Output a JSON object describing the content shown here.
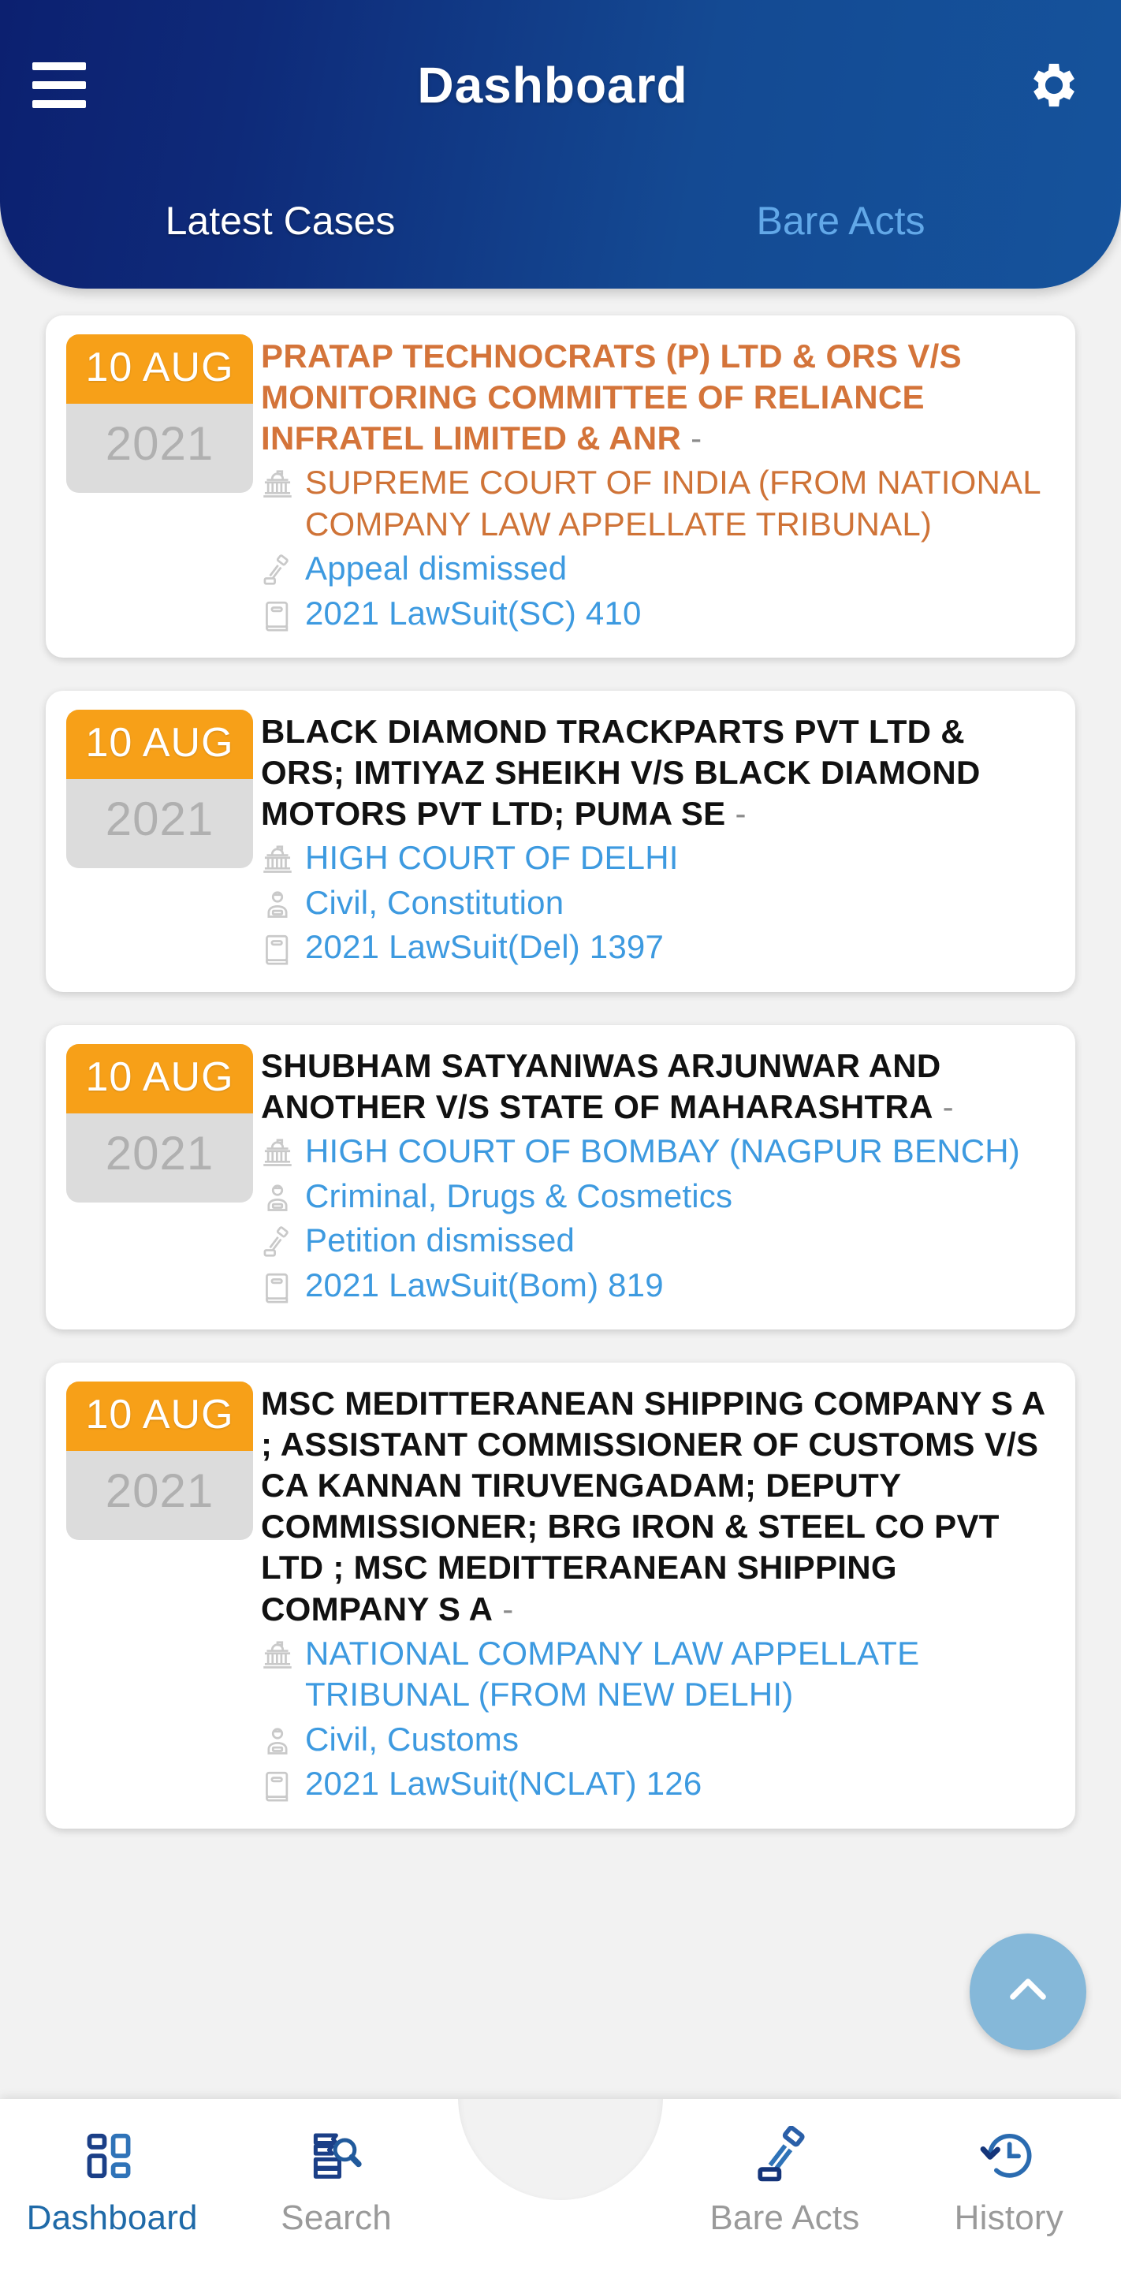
{
  "header": {
    "menu_icon": "hamburger-icon",
    "title": "Dashboard",
    "settings_icon": "gear-icon",
    "brand_gradient_start": "#0c2070",
    "brand_gradient_end": "#15539c",
    "tabs": [
      {
        "label": "Latest Cases",
        "active": true
      },
      {
        "label": "Bare Acts",
        "active": false
      }
    ]
  },
  "cards": [
    {
      "day": "10 AUG",
      "year": "2021",
      "title": "PRATAP TECHNOCRATS (P) LTD & ORS V/S MONITORING COMMITTEE OF RELIANCE INFRATEL LIMITED & ANR",
      "dash": " -",
      "highlighted": true,
      "court": "SUPREME COURT OF INDIA (FROM NATIONAL COMPANY LAW APPELLATE TRIBUNAL)",
      "category": null,
      "outcome": "Appeal dismissed",
      "citation": "2021 LawSuit(SC) 410"
    },
    {
      "day": "10 AUG",
      "year": "2021",
      "title": "BLACK DIAMOND TRACKPARTS PVT LTD & ORS; IMTIYAZ SHEIKH V/S BLACK DIAMOND MOTORS PVT LTD; PUMA SE",
      "dash": " -",
      "highlighted": false,
      "court": "HIGH COURT OF DELHI",
      "category": "Civil, Constitution",
      "outcome": null,
      "citation": "2021 LawSuit(Del) 1397"
    },
    {
      "day": "10 AUG",
      "year": "2021",
      "title": "SHUBHAM SATYANIWAS ARJUNWAR AND ANOTHER V/S STATE OF MAHARASHTRA",
      "dash": " -",
      "highlighted": false,
      "court": "HIGH COURT OF BOMBAY (NAGPUR BENCH)",
      "category": "Criminal, Drugs & Cosmetics",
      "outcome": "Petition dismissed",
      "citation": "2021 LawSuit(Bom) 819"
    },
    {
      "day": "10 AUG",
      "year": "2021",
      "title": "MSC MEDITTERANEAN SHIPPING COMPANY S A ; ASSISTANT COMMISSIONER OF CUSTOMS V/S CA KANNAN TIRUVENGADAM; DEPUTY COMMISSIONER; BRG IRON & STEEL CO PVT LTD ; MSC MEDITTERANEAN SHIPPING COMPANY S A",
      "dash": " -",
      "highlighted": false,
      "court": "NATIONAL COMPANY LAW APPELLATE TRIBUNAL (FROM NEW DELHI)",
      "category": "Civil, Customs",
      "outcome": null,
      "citation": "2021 LawSuit(NCLAT) 126"
    }
  ],
  "fab": {
    "icon": "chevron-up-icon",
    "color": "#85b8d9"
  },
  "bottom_nav": {
    "items": [
      {
        "label": "Dashboard",
        "icon": "grid-dashboard-icon",
        "active": true
      },
      {
        "label": "Search",
        "icon": "books-search-icon",
        "active": false
      },
      {
        "label": "Bare Acts",
        "icon": "gavel-icon",
        "active": false
      },
      {
        "label": "History",
        "icon": "clock-history-icon",
        "active": false
      }
    ],
    "active_color": "#1f6aa8",
    "inactive_color": "#9a9a9a"
  },
  "colors": {
    "date_badge_top": "#f7a018",
    "date_badge_bottom": "#dcdcdc",
    "link_blue": "#3d9ae0",
    "highlight_orange": "#d4743a"
  }
}
